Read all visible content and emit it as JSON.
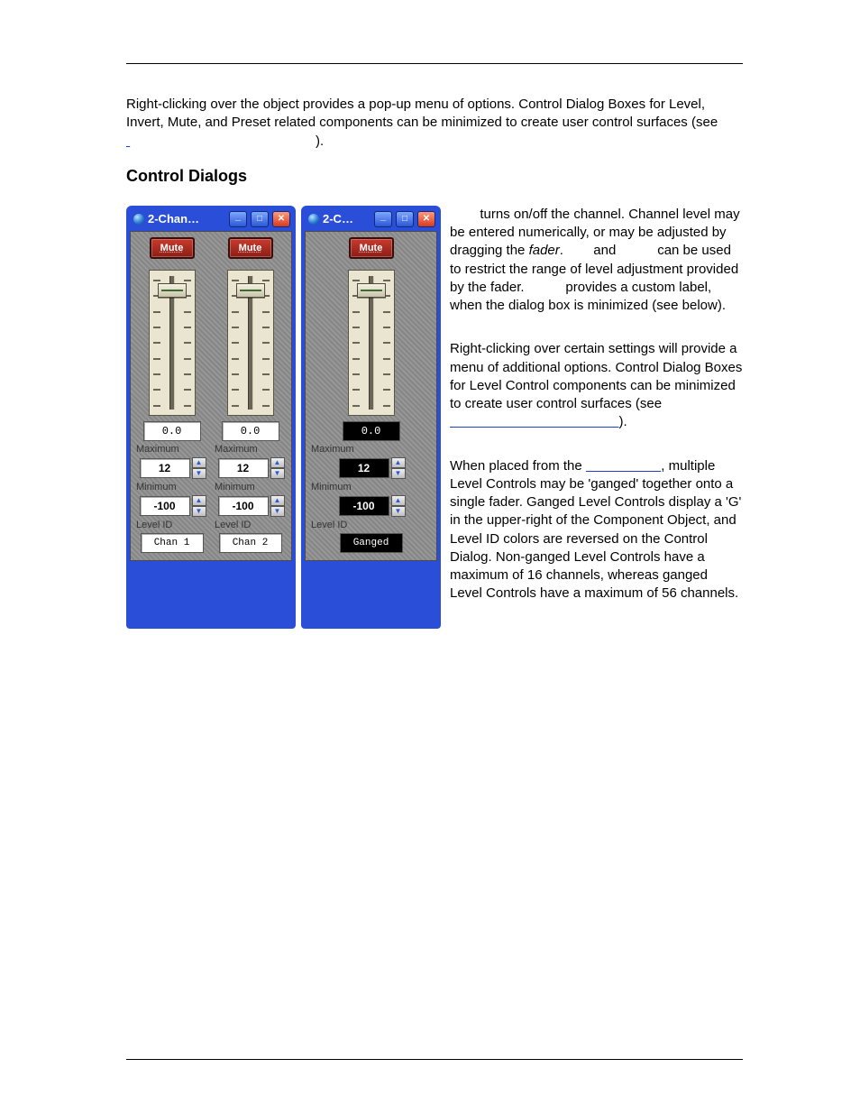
{
  "intro": {
    "text_before_link": "Right-clicking over the object provides a pop-up menu of options. Control Dialog Boxes for Level, Invert, Mute, and Preset related components can be minimized to create user control surfaces (see ",
    "text_after_link": ")."
  },
  "section_heading": "Control Dialogs",
  "dialogs": {
    "wide": {
      "title": "2-Chan…",
      "channels": [
        {
          "mute": "Mute",
          "level": "0.0",
          "max_label": "Maximum",
          "max": "12",
          "min_label": "Minimum",
          "min": "-100",
          "levelid_label": "Level ID",
          "levelid": "Chan 1"
        },
        {
          "mute": "Mute",
          "level": "0.0",
          "max_label": "Maximum",
          "max": "12",
          "min_label": "Minimum",
          "min": "-100",
          "levelid_label": "Level ID",
          "levelid": "Chan 2"
        }
      ]
    },
    "narrow": {
      "title": "2-C…",
      "channel": {
        "mute": "Mute",
        "level": "0.0",
        "max_label": "Maximum",
        "max": "12",
        "min_label": "Minimum",
        "min": "-100",
        "levelid_label": "Level ID",
        "levelid": "Ganged"
      }
    }
  },
  "rhs": {
    "p1_a": " turns on/off the channel. Channel level may be entered numerically, or may be adjusted by dragging the ",
    "p1_b": " and ",
    "p1_c": " can be used to restrict the range of level adjustment provided by the fader. ",
    "p1_d": " provides a custom label, when the dialog box is minimized (see below).",
    "p2_before": "Right-clicking over certain settings will provide a menu of additional options. Control Dialog Boxes for Level Control components can be minimized to create user control surfaces (see ",
    "p2_after": ").",
    "p3_before": "When placed from the ",
    "p3_after": ", multiple Level Controls may be 'ganged' together onto a single fader. Ganged Level Controls display a 'G' in the upper-right of the Component Object, and Level ID colors are reversed on the Control Dialog. Non-ganged Level Controls have a maximum of 16 channels, whereas ganged Level Controls have a maximum of 56 channels."
  },
  "glyphs": {
    "up": "▲",
    "down": "▼",
    "fader_word": "fader",
    "period": ". "
  }
}
